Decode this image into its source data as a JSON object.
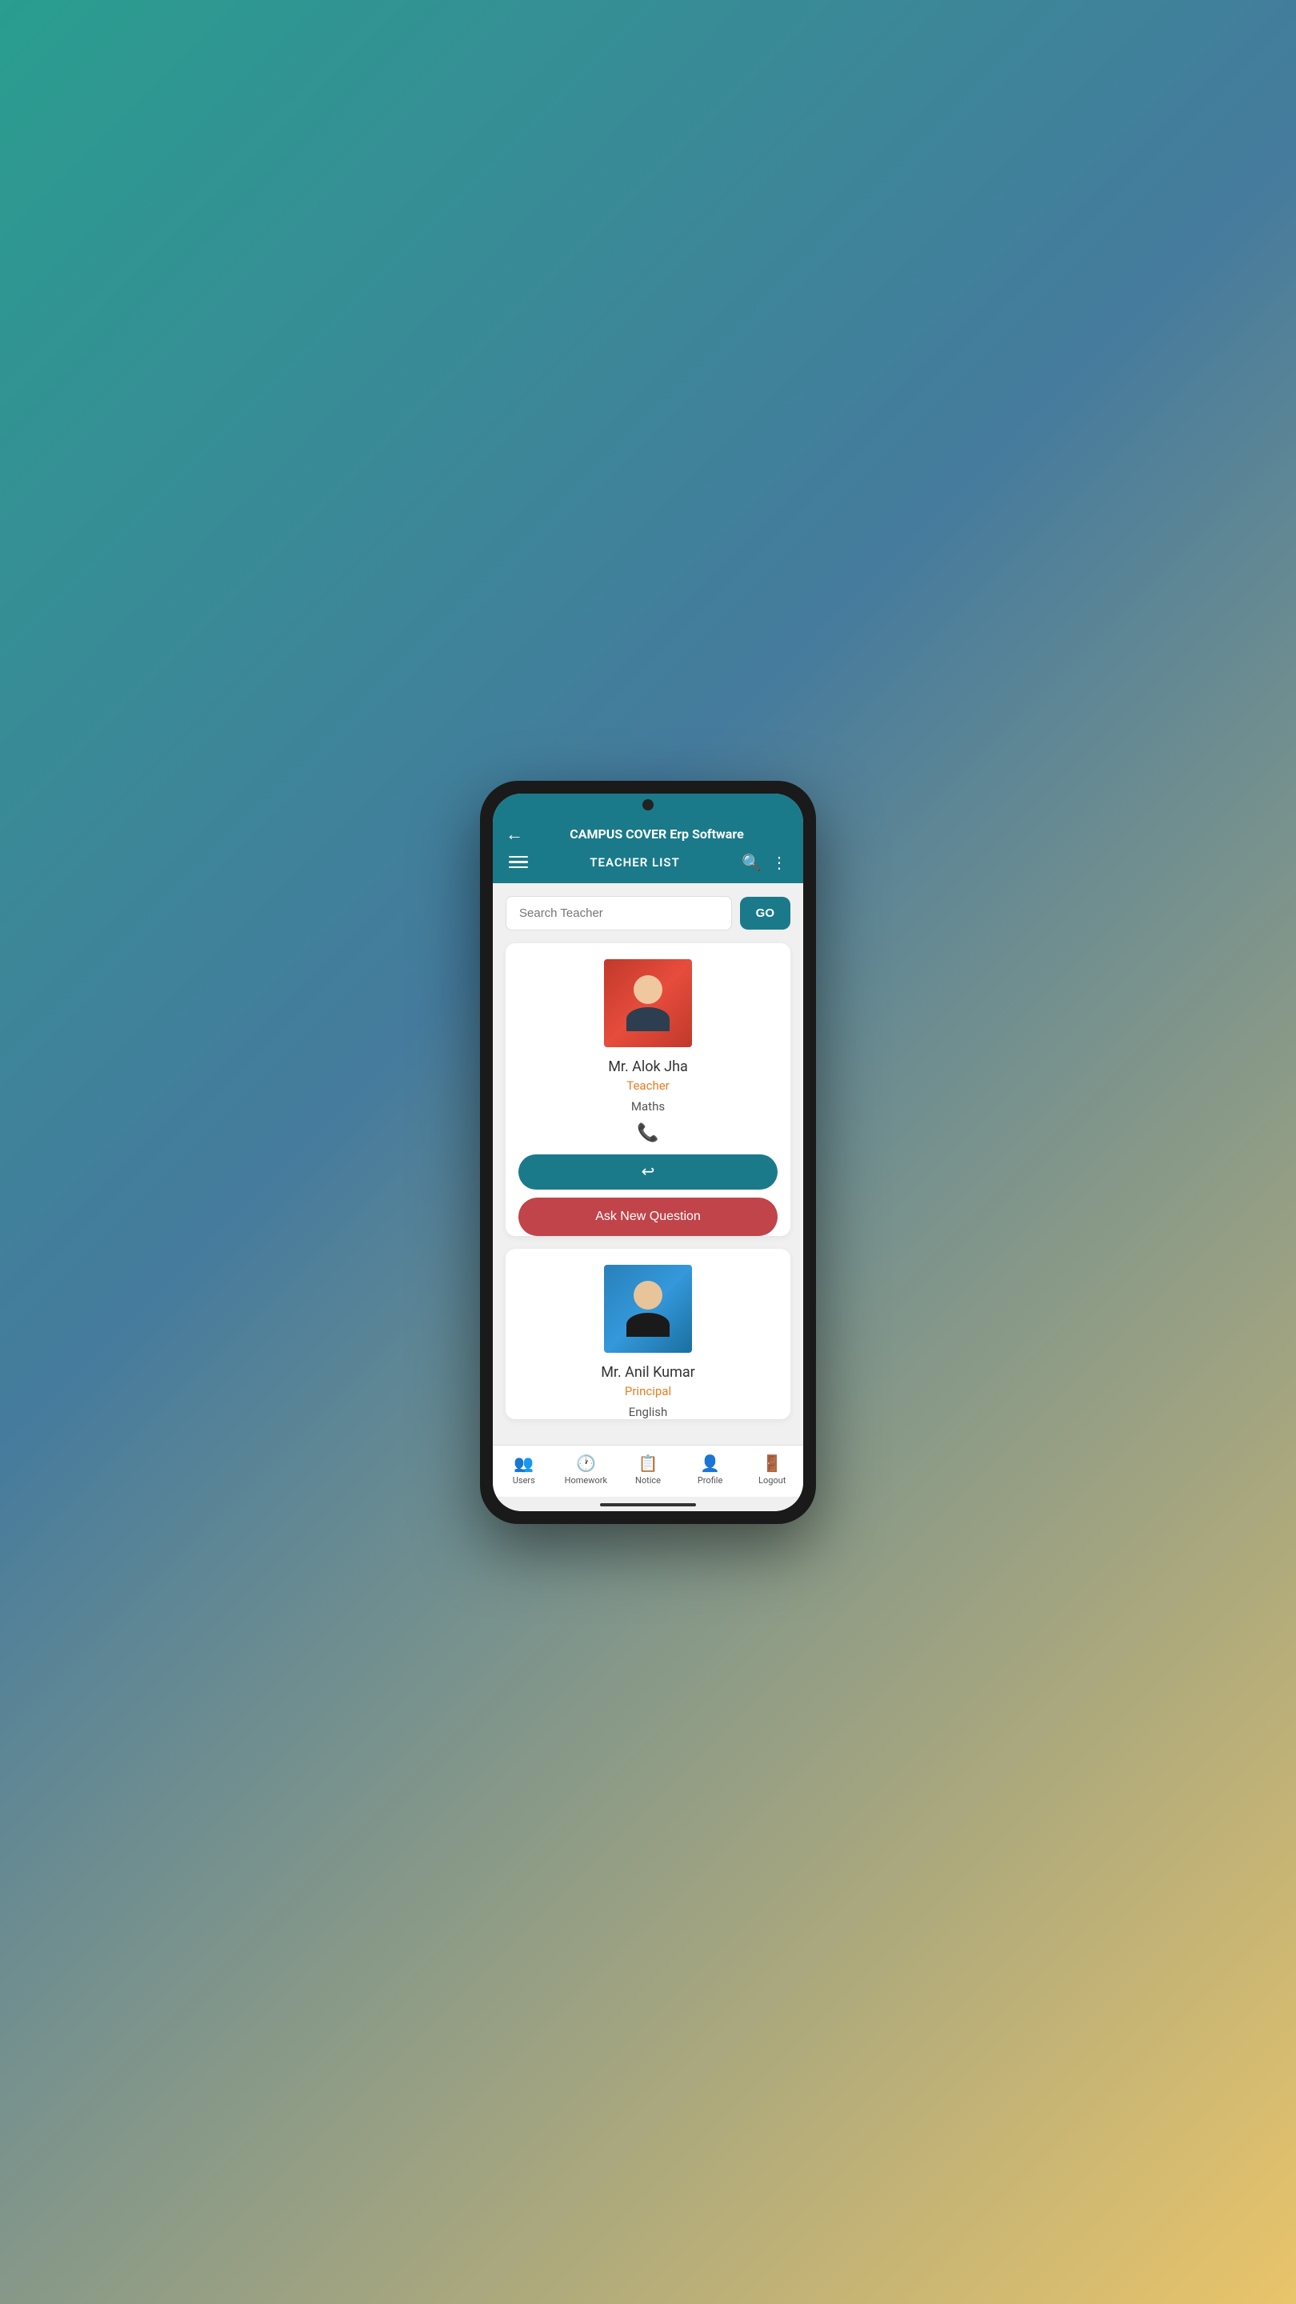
{
  "app": {
    "title": "CAMPUS COVER Erp Software",
    "section": "TEACHER LIST"
  },
  "search": {
    "placeholder": "Search Teacher",
    "go_label": "GO"
  },
  "teachers": [
    {
      "name": "Mr. Alok Jha",
      "role": "Teacher",
      "subject": "Maths",
      "photo_color": "alok"
    },
    {
      "name": "Mr. Anil Kumar",
      "role": "Principal",
      "subject": "English",
      "photo_color": "anil"
    }
  ],
  "buttons": {
    "reply_label": "↩",
    "ask_question": "Ask New Question"
  },
  "bottom_nav": [
    {
      "icon": "👥",
      "label": "Users"
    },
    {
      "icon": "🕐",
      "label": "Homework"
    },
    {
      "icon": "📋",
      "label": "Notice"
    },
    {
      "icon": "👤",
      "label": "Profile"
    },
    {
      "icon": "🚪",
      "label": "Logout"
    }
  ]
}
